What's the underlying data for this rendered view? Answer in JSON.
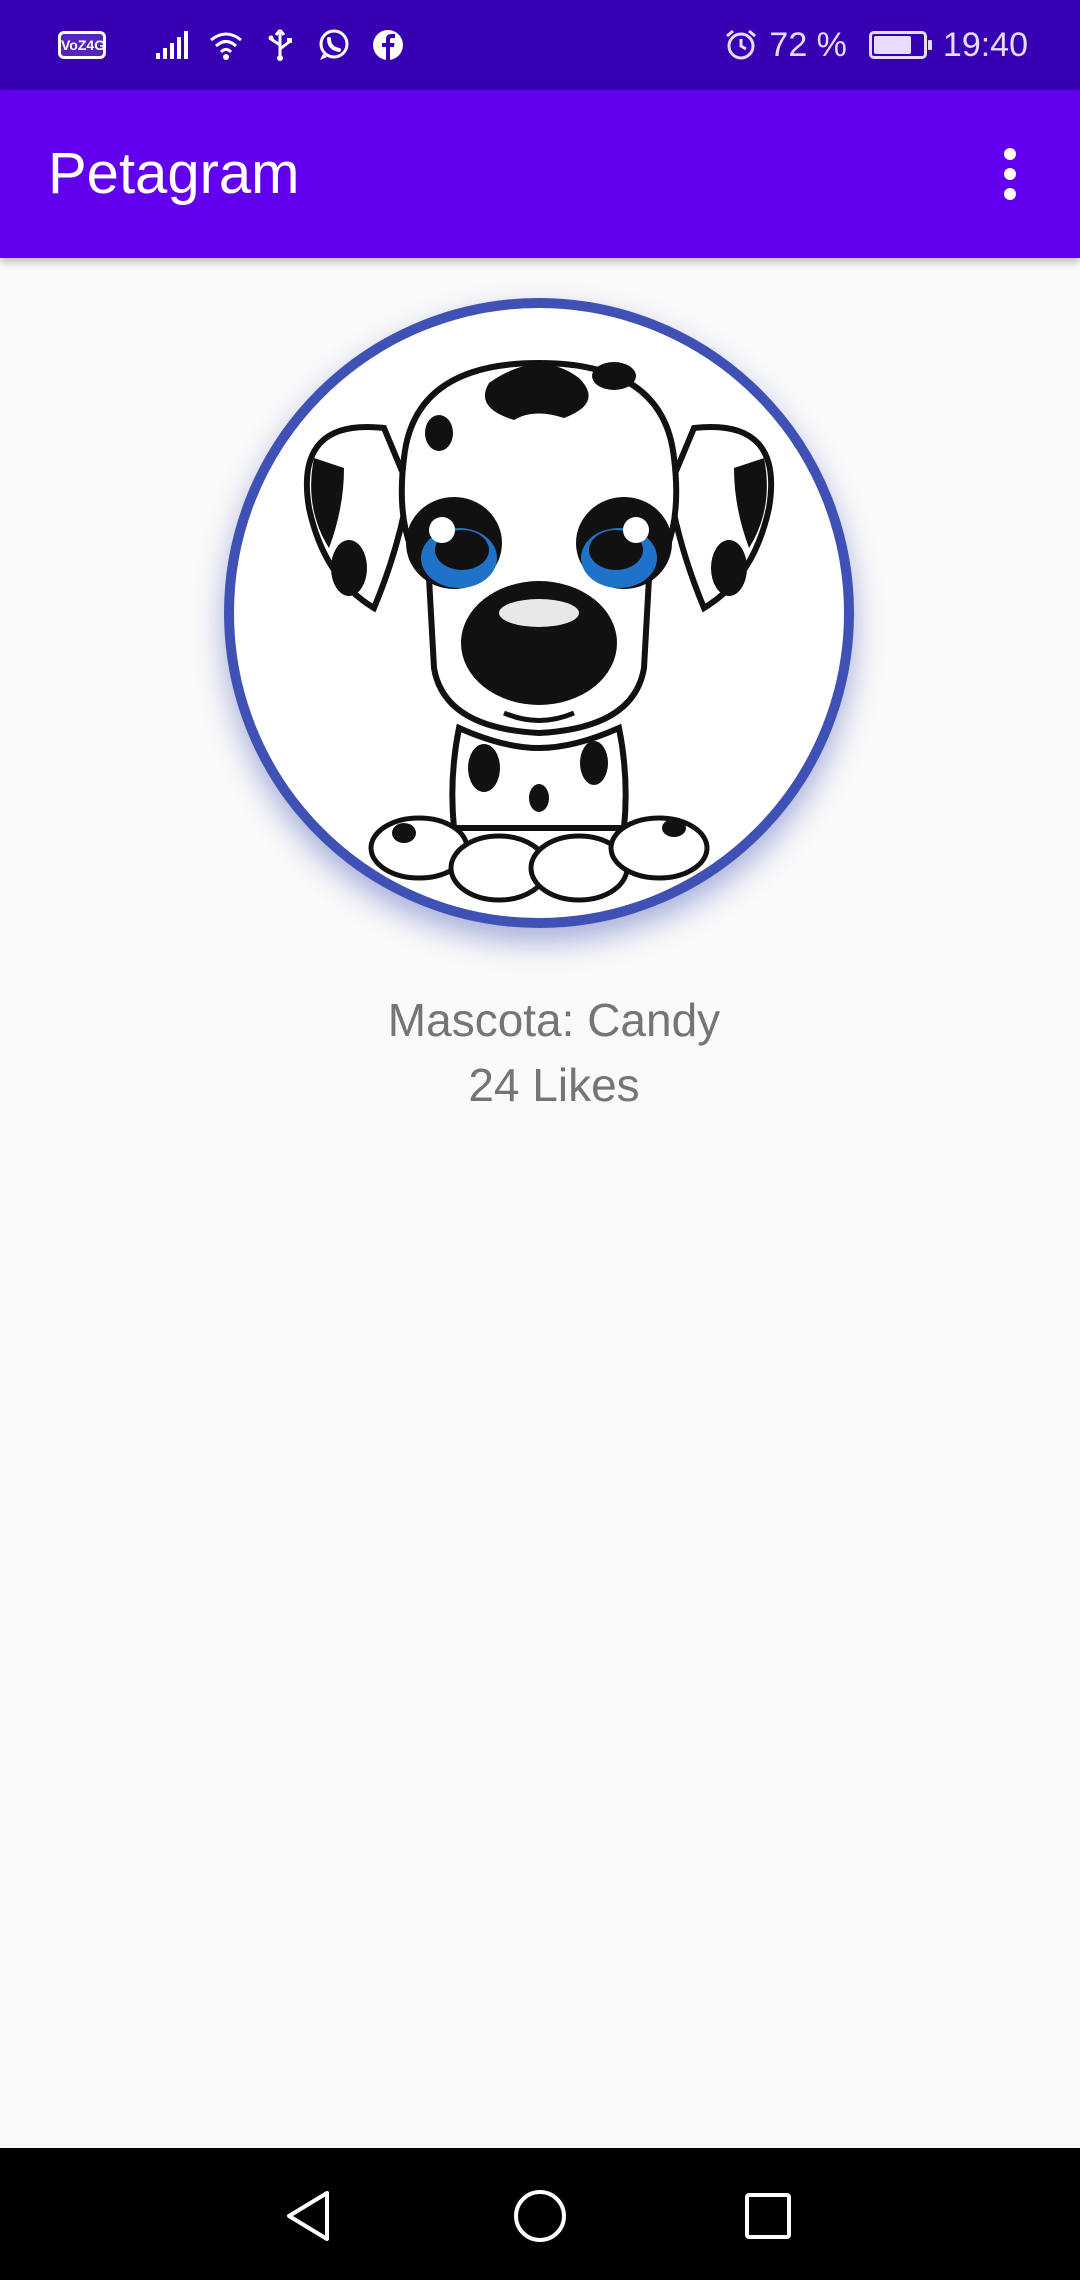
{
  "status_bar": {
    "network_badge": "VoZ4G",
    "battery_percent": "72 %",
    "battery_level": 0.72,
    "time": "19:40",
    "icons": [
      "volte-icon",
      "signal-icon",
      "wifi-icon",
      "usb-icon",
      "whatsapp-icon",
      "facebook-icon",
      "alarm-icon",
      "battery-icon"
    ]
  },
  "app_bar": {
    "title": "Petagram",
    "overflow_icon": "more-vert-icon"
  },
  "pet": {
    "image": "dalmatian-puppy-image",
    "name_line": "Mascota: Candy",
    "likes_line": "24 Likes"
  },
  "nav_bar": {
    "icons": [
      "back-icon",
      "home-icon",
      "recents-icon"
    ]
  },
  "colors": {
    "status_bar": "#3700b3",
    "app_bar": "#6200ee",
    "avatar_border": "#3f51b5",
    "background": "#fafafa",
    "secondary_text": "#757575"
  }
}
